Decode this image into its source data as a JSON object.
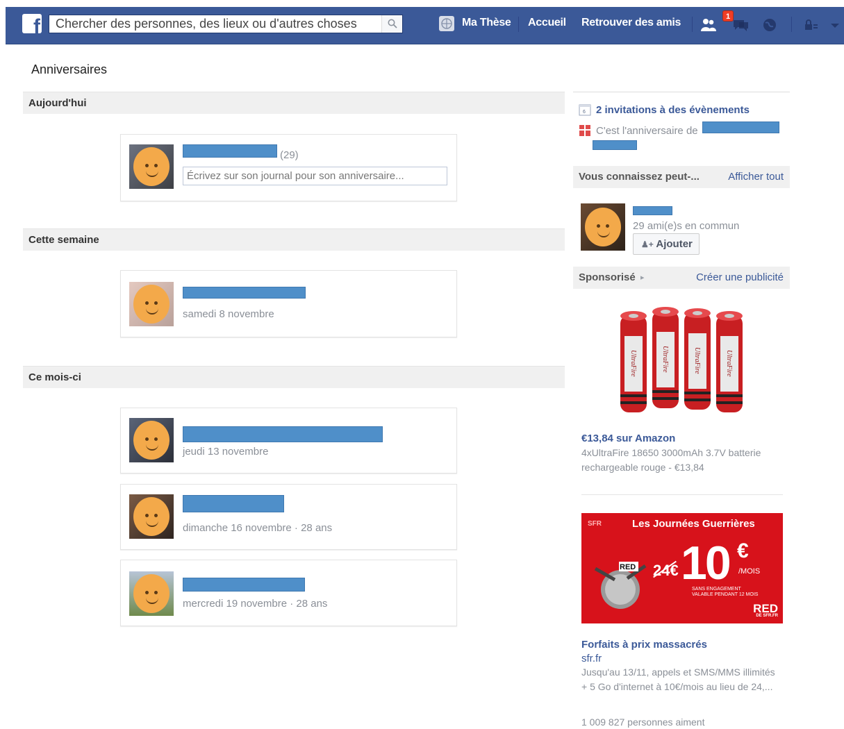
{
  "topbar": {
    "search_placeholder": "Chercher des personnes, des lieux ou d'autres choses",
    "nav": [
      "Ma Thèse",
      "Accueil",
      "Retrouver des amis"
    ],
    "friend_requests_badge": "1",
    "brand_color": "#3b5998"
  },
  "page": {
    "title": "Anniversaires"
  },
  "today": {
    "heading": "Aujourd'hui",
    "age": "(29)",
    "wall_placeholder": "Écrivez sur son journal pour son anniversaire..."
  },
  "this_week": {
    "heading": "Cette semaine",
    "items": [
      {
        "date": "samedi 8 novembre"
      }
    ]
  },
  "this_month": {
    "heading": "Ce mois-ci",
    "items": [
      {
        "date": "jeudi 13 novembre"
      },
      {
        "date": "dimanche 16 novembre · 28 ans"
      },
      {
        "date": "mercredi 19 novembre · 28 ans"
      }
    ]
  },
  "sidebar": {
    "events_link": "2 invitations à des évènements",
    "birthday_text": "C'est l'anniversaire de",
    "pymk": {
      "heading": "Vous connaissez peut-...",
      "see_all": "Afficher tout",
      "mutual": "29 ami(e)s en commun",
      "add_label": "Ajouter"
    },
    "sponsored": {
      "heading": "Sponsorisé",
      "create": "Créer une publicité"
    },
    "ads": [
      {
        "title": "€13,84 sur Amazon",
        "text": "4xUltraFire 18650 3000mAh 3.7V batterie rechargeable rouge - €13,84",
        "battery_label": "UltraFire"
      },
      {
        "title": "Forfaits à prix massacrés",
        "domain": "sfr.fr",
        "text": "Jusqu'au 13/11, appels et SMS/MMS illimités + 5 Go d'internet à 10€/mois au lieu de 24,...",
        "likes": "1 009 827 personnes aiment",
        "banner": {
          "tag": "SFR",
          "headline": "Les Journées Guerrières",
          "old_price": "24€",
          "price": "10",
          "currency": "€",
          "unit": "/MOIS",
          "conditions_1": "SANS ENGAGEMENT",
          "conditions_2": "VALABLE PENDANT 12 MOIS",
          "brand": "RED",
          "brand_sub": "DE SFR.FR"
        }
      }
    ]
  }
}
